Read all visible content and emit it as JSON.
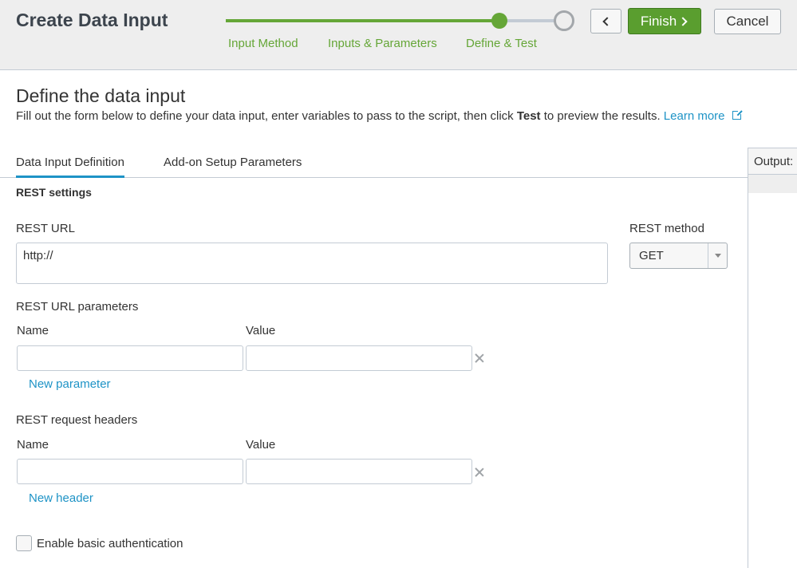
{
  "header": {
    "title": "Create Data Input",
    "steps": [
      {
        "label": "Input Method",
        "state": "done"
      },
      {
        "label": "Inputs & Parameters",
        "state": "done"
      },
      {
        "label": "Define & Test",
        "state": "current"
      },
      {
        "label": "",
        "state": "upcoming"
      }
    ],
    "back_icon": "chevron-left-icon",
    "finish_label": "Finish",
    "finish_icon": "chevron-right-icon",
    "cancel_label": "Cancel",
    "accent_color": "#65a637"
  },
  "page": {
    "heading": "Define the data input",
    "desc_before": "Fill out the form below to define your data input, enter variables to pass to the script, then click ",
    "desc_bold": "Test",
    "desc_after": " to preview the results. ",
    "learn_more": "Learn more",
    "learn_more_icon": "external-link-icon",
    "link_color": "#1e93c6"
  },
  "tabs": [
    {
      "label": "Data Input Definition",
      "active": true
    },
    {
      "label": "Add-on Setup Parameters",
      "active": false
    }
  ],
  "output": {
    "label": "Output:"
  },
  "form": {
    "section_title": "REST settings",
    "rest_url": {
      "label": "REST URL",
      "value": "http://"
    },
    "rest_method": {
      "label": "REST method",
      "value": "GET"
    },
    "url_params": {
      "label": "REST URL parameters",
      "name_label": "Name",
      "value_label": "Value",
      "rows": [
        {
          "name": "",
          "value": ""
        }
      ],
      "add_link": "New parameter"
    },
    "headers": {
      "label": "REST request headers",
      "name_label": "Name",
      "value_label": "Value",
      "rows": [
        {
          "name": "",
          "value": ""
        }
      ],
      "add_link": "New header"
    },
    "basic_auth": {
      "label": "Enable basic authentication",
      "checked": false
    }
  }
}
